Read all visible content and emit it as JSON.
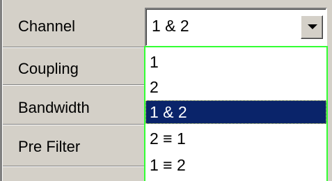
{
  "params": [
    {
      "label": "Channel"
    },
    {
      "label": "Coupling"
    },
    {
      "label": "Bandwidth"
    },
    {
      "label": "Pre Filter"
    }
  ],
  "channel_select": {
    "value": "1 & 2",
    "options": [
      {
        "label": "1",
        "selected": false
      },
      {
        "label": "2",
        "selected": false
      },
      {
        "label": "1 & 2",
        "selected": true
      },
      {
        "label": "2 ≡ 1",
        "selected": false
      },
      {
        "label": "1 ≡ 2",
        "selected": false
      }
    ]
  },
  "colors": {
    "panel_bg": "#d4d0c8",
    "selection_bg": "#0a246a",
    "dropdown_border": "#33ff33"
  }
}
